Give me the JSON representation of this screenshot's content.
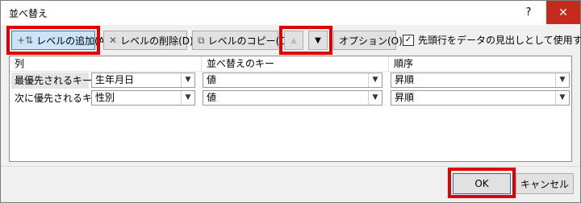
{
  "window": {
    "title": "並べ替え",
    "help_label": "?",
    "close_label": "✕"
  },
  "toolbar": {
    "add_level": "レベルの追加(A)",
    "delete_level": "レベルの削除(D)",
    "copy_level": "レベルのコピー(C)",
    "move_up": "▲",
    "move_down": "▼",
    "options": "オプション(O)...",
    "header_checkbox_label": "先頭行をデータの見出しとして使用する(H)",
    "header_checkbox_checked": true,
    "check_mark": "✓"
  },
  "grid": {
    "headers": {
      "column": "列",
      "sort_on": "並べ替えのキー",
      "order": "順序"
    },
    "rows": [
      {
        "label": "最優先されるキー",
        "column": "生年月日",
        "sort_on": "値",
        "order": "昇順"
      },
      {
        "label": "次に優先されるキー",
        "column": "性別",
        "sort_on": "値",
        "order": "昇順"
      }
    ]
  },
  "footer": {
    "ok": "OK",
    "cancel": "キャンセル"
  },
  "colors": {
    "highlight": "#e00000",
    "selected_button": "#cce4f7",
    "close_button": "#c42b1c"
  }
}
